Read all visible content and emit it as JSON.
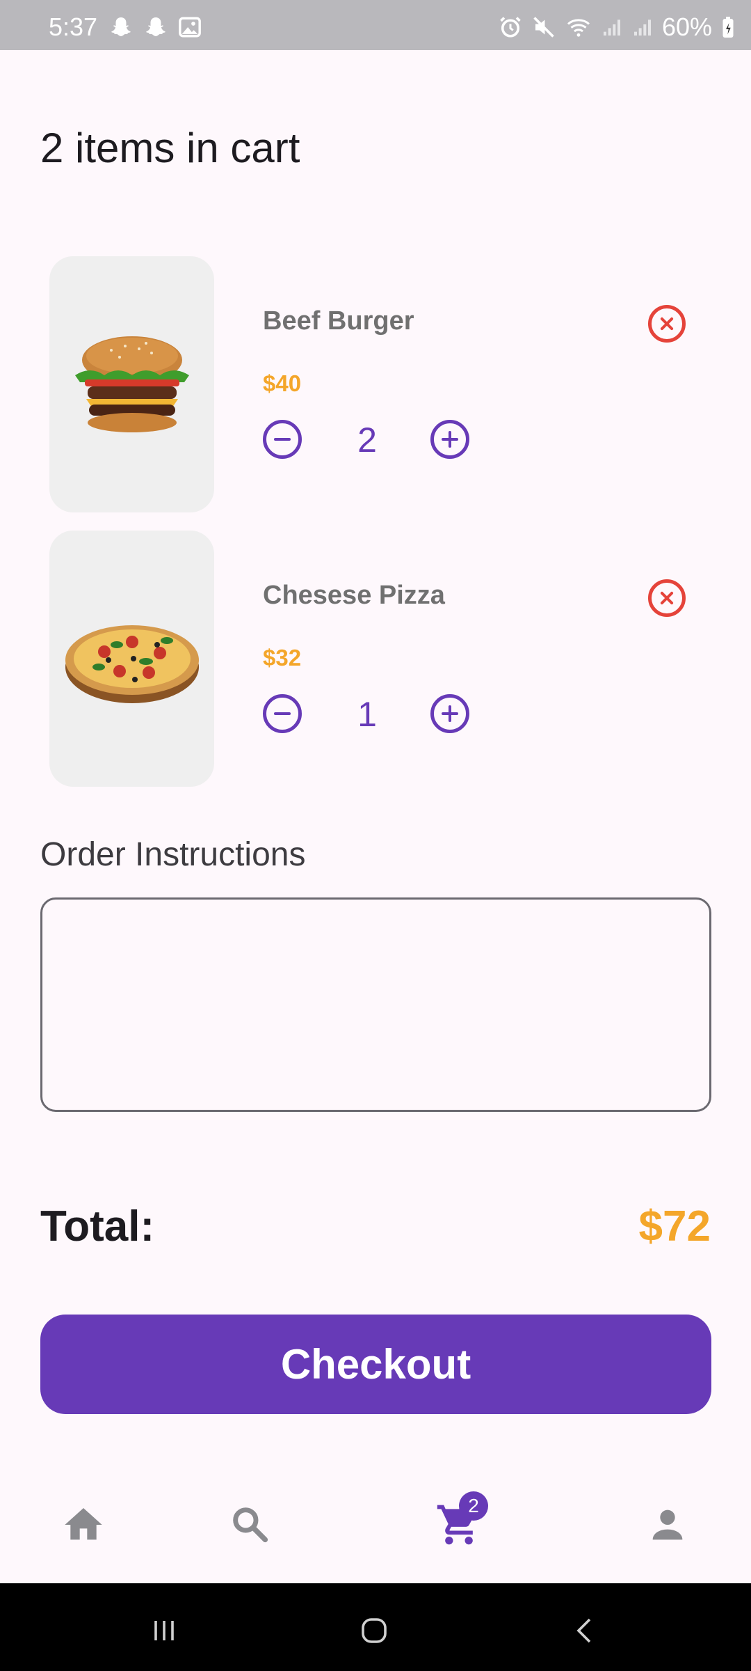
{
  "status_bar": {
    "time": "5:37",
    "battery_percent": "60%",
    "left_icons": [
      "snapchat-icon",
      "snapchat-icon",
      "gallery-icon"
    ],
    "right_icons": [
      "alarm-icon",
      "mute-icon",
      "wifi-icon",
      "signal-icon",
      "signal-icon",
      "battery-icon"
    ]
  },
  "page": {
    "title": "2 items in cart"
  },
  "cart": {
    "items": [
      {
        "name": "Beef Burger",
        "price": "$40",
        "quantity": "2",
        "image": "burger-image"
      },
      {
        "name": "Chesese Pizza",
        "price": "$32",
        "quantity": "1",
        "image": "pizza-image"
      }
    ]
  },
  "instructions": {
    "label": "Order Instructions",
    "value": "",
    "placeholder": ""
  },
  "total": {
    "label": "Total:",
    "value": "$72"
  },
  "checkout": {
    "label": "Checkout"
  },
  "bottom_nav": {
    "items": [
      {
        "icon": "home-icon",
        "active": false
      },
      {
        "icon": "search-icon",
        "active": false
      },
      {
        "icon": "cart-icon",
        "active": true,
        "badge": "2"
      },
      {
        "icon": "profile-icon",
        "active": false
      }
    ]
  },
  "colors": {
    "accent": "#673ab7",
    "price": "#f4a62a",
    "remove": "#e5433a",
    "background": "#fef8fc"
  }
}
